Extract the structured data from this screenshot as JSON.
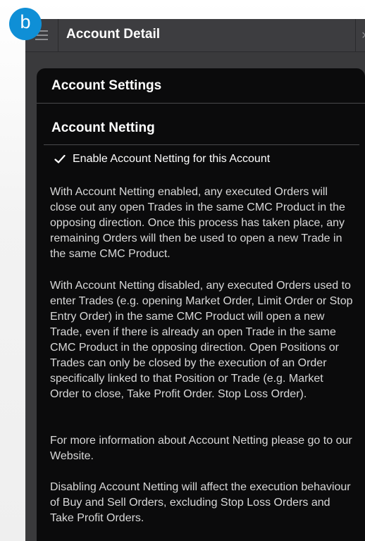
{
  "badge": "b",
  "header": {
    "title": "Account Detail",
    "menu_icon": "hamburger-menu-icon",
    "close_icon": "close-icon",
    "close_glyph": "×"
  },
  "panel": {
    "settings_title": "Account Settings",
    "netting_title": "Account Netting",
    "checkbox_label": "Enable Account Netting for this Account",
    "checkbox_checked": true,
    "paragraphs": [
      "With Account Netting enabled, any executed Orders will close out any open Trades in the same CMC Product in the opposing direction. Once this process has taken place, any remaining Orders will then be used to open a new Trade in the same CMC Product.",
      "With Account Netting disabled, any executed Orders used to enter Trades (e.g. opening Market Order, Limit Order or Stop Entry Order) in the same CMC Product will open a new Trade, even if there is already an open Trade in the same CMC Product in the opposing direction. Open Positions or Trades can only be closed by the execution of an Order specifically linked to that Position or Trade (e.g. Market Order to close, Take Profit Order. Stop Loss Order).",
      "For more information about Account Netting please go to our Website.",
      "Disabling Account Netting will affect the execution behaviour of Buy and Sell Orders, excluding Stop Loss Orders and Take Profit Orders."
    ]
  },
  "colors": {
    "badge": "#0f8fd6",
    "titlebar": "#3d3d40",
    "panel": "#0b0b0c",
    "text": "#d8d8d8"
  }
}
